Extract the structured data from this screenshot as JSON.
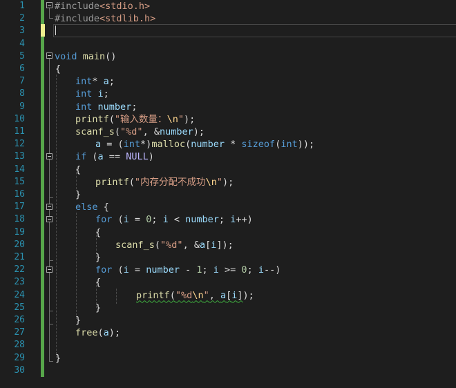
{
  "editor": {
    "line_numbers": [
      "1",
      "2",
      "3",
      "4",
      "5",
      "6",
      "7",
      "8",
      "9",
      "10",
      "11",
      "12",
      "13",
      "14",
      "15",
      "16",
      "17",
      "18",
      "19",
      "20",
      "21",
      "22",
      "23",
      "24",
      "25",
      "26",
      "27",
      "28",
      "29",
      "30"
    ],
    "colors": {
      "background": "#1e1e1e",
      "line_number": "#2b91af",
      "change_bar": "#57a64a",
      "current_line_marker": "#efef8f",
      "keyword": "#569cd6",
      "string": "#d69d85",
      "function": "#dcdcaa"
    },
    "code": {
      "l1": {
        "p1": "#include",
        "p2": "<stdio.h>"
      },
      "l2": {
        "p1": "#include",
        "p2": "<stdlib.h>"
      },
      "l5": {
        "p1": "void",
        "p2": " ",
        "p3": "main",
        "p4": "()"
      },
      "l6": {
        "p1": "{"
      },
      "l7": {
        "p1": "int",
        "p2": "* ",
        "p3": "a",
        "p4": ";"
      },
      "l8": {
        "p1": "int",
        "p2": " ",
        "p3": "i",
        "p4": ";"
      },
      "l9": {
        "p1": "int",
        "p2": " ",
        "p3": "number",
        "p4": ";"
      },
      "l10": {
        "p1": "printf",
        "p2": "(",
        "p3": "\"输入数量：",
        "p4": "\\n",
        "p5": "\"",
        "p6": ");"
      },
      "l11": {
        "p1": "scanf_s",
        "p2": "(",
        "p3": "\"%d\"",
        "p4": ", &",
        "p5": "number",
        "p6": ");"
      },
      "l12": {
        "p1": "a",
        "p2": " = (",
        "p3": "int",
        "p4": "*)",
        "p5": "malloc",
        "p6": "(",
        "p7": "number",
        "p8": " * ",
        "p9": "sizeof",
        "p10": "(",
        "p11": "int",
        "p12": "));"
      },
      "l13": {
        "p1": "if",
        "p2": " (",
        "p3": "a",
        "p4": " == ",
        "p5": "NULL",
        "p6": ")"
      },
      "l14": {
        "p1": "{"
      },
      "l15": {
        "p1": "printf",
        "p2": "(",
        "p3": "\"内存分配不成功",
        "p4": "\\n",
        "p5": "\"",
        "p6": ");"
      },
      "l16": {
        "p1": "}"
      },
      "l17": {
        "p1": "else",
        "p2": " {"
      },
      "l18": {
        "p1": "for",
        "p2": " (",
        "p3": "i",
        "p4": " = ",
        "p5": "0",
        "p6": "; ",
        "p7": "i",
        "p8": " < ",
        "p9": "number",
        "p10": "; ",
        "p11": "i",
        "p12": "++)"
      },
      "l19": {
        "p1": "{"
      },
      "l20": {
        "p1": "scanf_s",
        "p2": "(",
        "p3": "\"%d\"",
        "p4": ", &",
        "p5": "a",
        "p6": "[",
        "p7": "i",
        "p8": "]);"
      },
      "l21": {
        "p1": "}"
      },
      "l22": {
        "p1": "for",
        "p2": " (",
        "p3": "i",
        "p4": " = ",
        "p5": "number",
        "p6": " - ",
        "p7": "1",
        "p8": "; ",
        "p9": "i",
        "p10": " >= ",
        "p11": "0",
        "p12": "; ",
        "p13": "i",
        "p14": "--)"
      },
      "l23": {
        "p1": "{"
      },
      "l24": {
        "p1": "printf",
        "p2": "(",
        "p3": "\"%d",
        "p4": "\\n",
        "p5": "\"",
        "p6": ", ",
        "p7": "a",
        "p8": "[",
        "p9": "i",
        "p10": "]",
        "p11": ");"
      },
      "l25": {
        "p1": "}"
      },
      "l26": {
        "p1": "}"
      },
      "l27": {
        "p1": "free",
        "p2": "(",
        "p3": "a",
        "p4": ");"
      },
      "l29": {
        "p1": "}"
      }
    }
  }
}
